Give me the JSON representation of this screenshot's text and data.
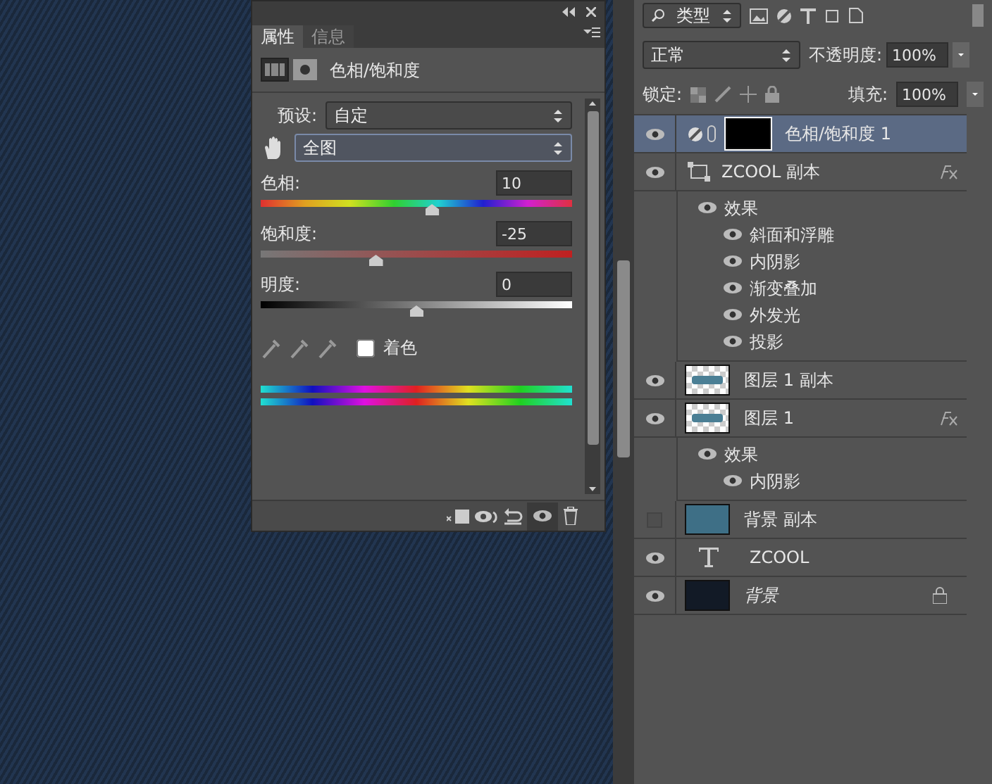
{
  "properties_panel": {
    "tabs": [
      {
        "label": "属性",
        "selected": true
      },
      {
        "label": "信息",
        "selected": false
      }
    ],
    "title": "色相/饱和度",
    "preset": {
      "label": "预设:",
      "value": "自定"
    },
    "range": {
      "value": "全图"
    },
    "sliders": [
      {
        "kind": "hue",
        "label": "色相:",
        "value": "10",
        "level": 0.55
      },
      {
        "kind": "saturation",
        "label": "饱和度:",
        "value": "-25",
        "level": 0.37
      },
      {
        "kind": "lightness",
        "label": "明度:",
        "value": "0",
        "level": 0.5
      }
    ],
    "colorize": {
      "label": "着色",
      "checked": false
    }
  },
  "layers_panel": {
    "filter": {
      "value": "类型"
    },
    "blend_mode": "正常",
    "opacity": {
      "label": "不透明度:",
      "value": "100%"
    },
    "lock_label": "锁定:",
    "fill": {
      "label": "填充:",
      "value": "100%"
    },
    "layers": [
      {
        "kind": "adjustment",
        "name": "色相/饱和度 1",
        "visible": true,
        "selected": true,
        "fx": false,
        "locked": false
      },
      {
        "kind": "shape",
        "name": "ZCOOL 副本",
        "visible": true,
        "selected": false,
        "fx": true,
        "locked": false,
        "effects_label": "效果",
        "effects": [
          {
            "name": "斜面和浮雕",
            "visible": true
          },
          {
            "name": "内阴影",
            "visible": true
          },
          {
            "name": "渐变叠加",
            "visible": true
          },
          {
            "name": "外发光",
            "visible": true
          },
          {
            "name": "投影",
            "visible": true
          }
        ]
      },
      {
        "kind": "pixel",
        "name": "图层 1 副本",
        "visible": true,
        "selected": false,
        "fx": false,
        "locked": false
      },
      {
        "kind": "pixel",
        "name": "图层 1",
        "visible": true,
        "selected": false,
        "fx": true,
        "locked": false,
        "effects_label": "效果",
        "effects": [
          {
            "name": "内阴影",
            "visible": true
          }
        ]
      },
      {
        "kind": "solid",
        "name": "背景 副本",
        "color": "#3e6f86",
        "visible": false,
        "selected": false,
        "fx": false,
        "locked": false
      },
      {
        "kind": "text",
        "name": "ZCOOL",
        "visible": true,
        "selected": false,
        "fx": false,
        "locked": false
      },
      {
        "kind": "solid",
        "name": "背景",
        "color": "#121a26",
        "visible": true,
        "selected": false,
        "fx": false,
        "locked": true
      }
    ]
  }
}
